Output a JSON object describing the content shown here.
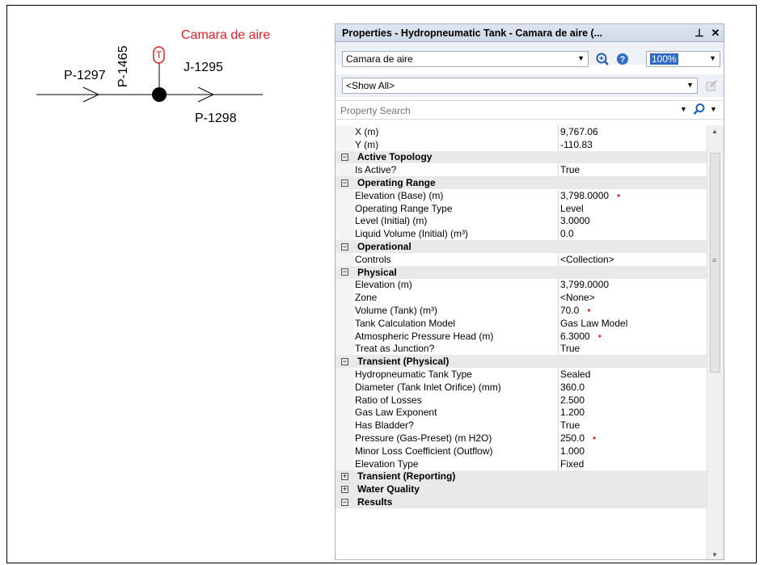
{
  "network": {
    "tank_label": "Camara de aire",
    "labels": {
      "p1297": "P-1297",
      "p1465": "P-1465",
      "j1295": "J-1295",
      "p1298": "P-1298"
    },
    "colors": {
      "tank": "#e21f26",
      "pipe": "#000000"
    }
  },
  "panel": {
    "title": "Properties - Hydropneumatic Tank - Camara de aire (...",
    "pin_icon": "pin-icon",
    "close_icon": "close-icon",
    "element_select": "Camara de aire",
    "zoom_value": "100%",
    "filter_select": "<Show All>",
    "search_placeholder": "Property Search",
    "rows": [
      {
        "type": "prop",
        "name": "X (m)",
        "value": "9,767.06",
        "dot": false
      },
      {
        "type": "prop",
        "name": "Y (m)",
        "value": "-110.83",
        "dot": false
      },
      {
        "type": "cat",
        "name": "Active Topology",
        "toggle": "−"
      },
      {
        "type": "prop",
        "name": "Is Active?",
        "value": "True",
        "dot": false
      },
      {
        "type": "cat",
        "name": "Operating Range",
        "toggle": "−"
      },
      {
        "type": "prop",
        "name": "Elevation (Base) (m)",
        "value": "3,798.0000",
        "dot": true
      },
      {
        "type": "prop",
        "name": "Operating Range Type",
        "value": "Level",
        "dot": false
      },
      {
        "type": "prop",
        "name": "Level (Initial) (m)",
        "value": "3.0000",
        "dot": false
      },
      {
        "type": "prop",
        "name": "Liquid Volume (Initial) (m³)",
        "value": "0.0",
        "dot": false
      },
      {
        "type": "cat",
        "name": "Operational",
        "toggle": "−"
      },
      {
        "type": "prop",
        "name": "Controls",
        "value": "<Collection>",
        "dot": false
      },
      {
        "type": "cat",
        "name": "Physical",
        "toggle": "−"
      },
      {
        "type": "prop",
        "name": "Elevation (m)",
        "value": "3,799.0000",
        "dot": false
      },
      {
        "type": "prop",
        "name": "Zone",
        "value": "<None>",
        "dot": false
      },
      {
        "type": "prop",
        "name": "Volume (Tank) (m³)",
        "value": "70.0",
        "dot": true
      },
      {
        "type": "prop",
        "name": "Tank Calculation Model",
        "value": "Gas Law Model",
        "dot": false
      },
      {
        "type": "prop",
        "name": "Atmospheric Pressure Head (m)",
        "value": "6.3000",
        "dot": true
      },
      {
        "type": "prop",
        "name": "Treat as Junction?",
        "value": "True",
        "dot": false
      },
      {
        "type": "cat",
        "name": "Transient (Physical)",
        "toggle": "−"
      },
      {
        "type": "prop",
        "name": "Hydropneumatic Tank Type",
        "value": "Sealed",
        "dot": false
      },
      {
        "type": "prop",
        "name": "Diameter (Tank Inlet Orifice) (mm)",
        "value": "360.0",
        "dot": false
      },
      {
        "type": "prop",
        "name": "Ratio of Losses",
        "value": "2.500",
        "dot": false
      },
      {
        "type": "prop",
        "name": "Gas Law Exponent",
        "value": "1.200",
        "dot": false
      },
      {
        "type": "prop",
        "name": "Has Bladder?",
        "value": "True",
        "dot": false
      },
      {
        "type": "prop",
        "name": "Pressure (Gas-Preset) (m H2O)",
        "value": "250.0",
        "dot": true
      },
      {
        "type": "prop",
        "name": "Minor Loss Coefficient (Outflow)",
        "value": "1.000",
        "dot": false
      },
      {
        "type": "prop",
        "name": "Elevation Type",
        "value": "Fixed",
        "dot": false
      },
      {
        "type": "cat",
        "name": "Transient (Reporting)",
        "toggle": "+"
      },
      {
        "type": "cat",
        "name": "Water Quality",
        "toggle": "+"
      },
      {
        "type": "cat",
        "name": "Results",
        "toggle": "−"
      }
    ]
  }
}
